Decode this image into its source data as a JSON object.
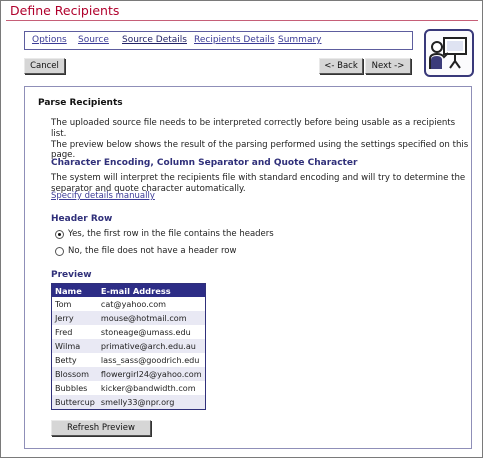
{
  "window": {
    "title": "Define Recipients"
  },
  "tabs": [
    {
      "label": "Options"
    },
    {
      "label": "Source"
    },
    {
      "label": "Source Details"
    },
    {
      "label": "Recipients Details"
    },
    {
      "label": "Summary"
    }
  ],
  "buttons": {
    "cancel": "Cancel",
    "back": "<- Back",
    "next": "Next ->",
    "refresh": "Refresh Preview"
  },
  "panel": {
    "heading": "Parse Recipients",
    "intro_lines": [
      "The uploaded source file needs to be interpreted correctly before being usable as a recipients list.",
      "The preview below shows the result of the parsing performed using the settings specified on this",
      "page."
    ],
    "encoding": {
      "heading": "Character Encoding, Column Separator and Quote Character",
      "lines": [
        "The system will interpret the recipients file with standard encoding and will try to determine the",
        "separator and quote character automatically."
      ],
      "link": "Specify details manually"
    },
    "header_row": {
      "heading": "Header Row",
      "options": [
        {
          "label": "Yes, the first row in the file contains the headers",
          "selected": true
        },
        {
          "label": "No, the file does not have a header row",
          "selected": false
        }
      ]
    },
    "preview": {
      "heading": "Preview",
      "columns": [
        "Name",
        "E-mail Address"
      ],
      "rows": [
        [
          "Tom",
          "cat@yahoo.com"
        ],
        [
          "Jerry",
          "mouse@hotmail.com"
        ],
        [
          "Fred",
          "stoneage@umass.edu"
        ],
        [
          "Wilma",
          "primative@arch.edu.au"
        ],
        [
          "Betty",
          "lass_sass@goodrich.edu"
        ],
        [
          "Blossom",
          "flowergirl24@yahoo.com"
        ],
        [
          "Bubbles",
          "kicker@bandwidth.com"
        ],
        [
          "Buttercup",
          "smelly33@npr.org"
        ]
      ]
    }
  },
  "icons": {
    "wizard": "presenter-board-icon"
  },
  "colors": {
    "title": "#b0002c",
    "accent": "#2d2d86",
    "link": "#3b3b96"
  }
}
